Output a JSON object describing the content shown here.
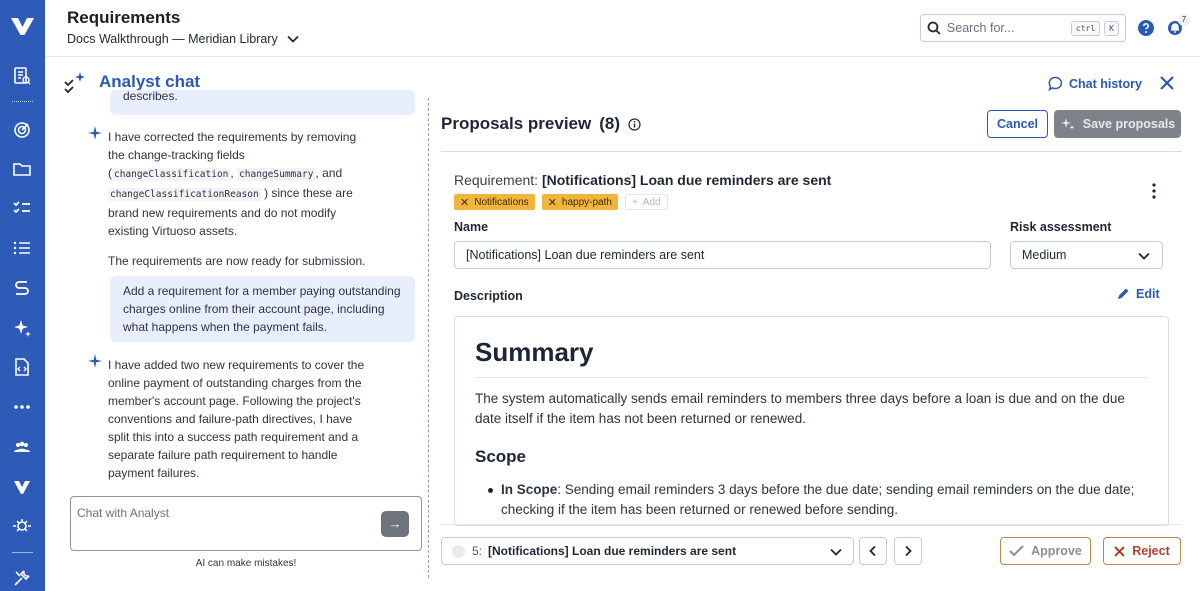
{
  "header": {
    "title": "Requirements",
    "breadcrumb": "Docs Walkthrough — Meridian Library",
    "search_placeholder": "Search for...",
    "shortcut_ctrl": "ctrl",
    "shortcut_key": "K",
    "notification_count": "7"
  },
  "chat": {
    "title": "Analyst chat",
    "history_label": "Chat history",
    "top_bubble_fragment": "describes.",
    "messages": {
      "ai1_line1": "I have corrected the requirements by removing",
      "ai1_line2": "the change-tracking fields",
      "ai1_code1": "changeClassification",
      "ai1_code2": "changeSummary",
      "ai1_and": ", and",
      "ai1_code3": "changeClassificationReason",
      "ai1_rest1": ") since these are",
      "ai1_line5": "brand new requirements and do not modify",
      "ai1_line6": "existing Virtuoso assets.",
      "ai1_ready": "The requirements are now ready for submission.",
      "user2": "Add a requirement for a member paying outstanding charges online from their account page, including what happens when the payment fails.",
      "ai2": "I have added two new requirements to cover the online payment of outstanding charges from the member's account page. Following the project's conventions and failure-path directives, I have split this into a success path requirement and a separate failure path requirement to handle payment failures."
    },
    "input_placeholder": "Chat with Analyst",
    "send_label": "→",
    "disclaimer": "AI can make mistakes!"
  },
  "proposals": {
    "title": "Proposals preview",
    "count": "(8)",
    "cancel_label": "Cancel",
    "save_label": "Save proposals",
    "requirement_prefix": "Requirement:",
    "requirement_name": "[Notifications] Loan due reminders are sent",
    "tags": [
      "Notifications",
      "happy-path"
    ],
    "add_tag_label": "Add",
    "name_label": "Name",
    "name_value": "[Notifications] Loan due reminders are sent",
    "risk_label": "Risk assessment",
    "risk_value": "Medium",
    "description_label": "Description",
    "edit_label": "Edit",
    "description": {
      "h1": "Summary",
      "summary": "The system automatically sends email reminders to members three days before a loan is due and on the due date itself if the item has not been returned or renewed.",
      "h2": "Scope",
      "bullet_label": "In Scope",
      "bullet_text": ": Sending email reminders 3 days before the due date; sending email reminders on the due date; checking if the item has been returned or renewed before sending."
    },
    "selector": {
      "index": "5:",
      "label": "[Notifications] Loan due reminders are sent"
    },
    "approve_label": "Approve",
    "reject_label": "Reject"
  },
  "colors": {
    "rail": "#2f5bb8",
    "accent": "#2b59b6",
    "tag": "#f2b53c",
    "reject": "#b0412d"
  }
}
